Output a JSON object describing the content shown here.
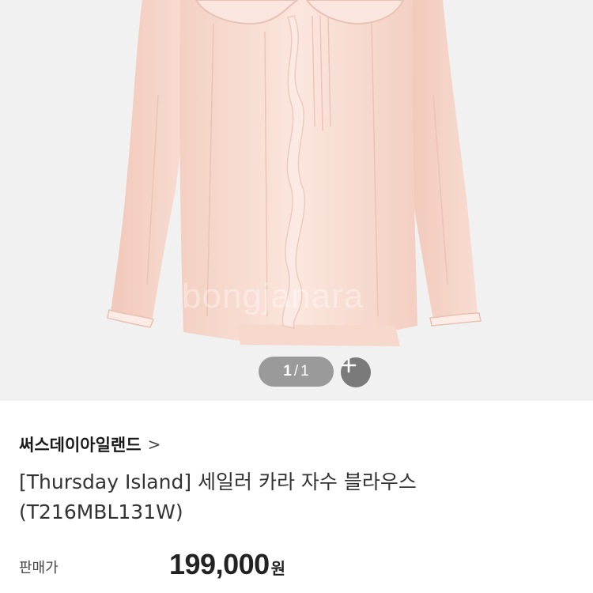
{
  "gallery": {
    "current": "1",
    "separator": "/",
    "total": "1",
    "zoom_icon": "plus-icon",
    "watermark": "bongjanara",
    "colors": {
      "background": "#f1f1f1",
      "blouse": "#f8ddd3",
      "pill": "#7a7a7a"
    }
  },
  "product": {
    "brand": "써스데이아일랜드",
    "brand_chevron": ">",
    "name_line1": "[Thursday Island] 세일러 카라 자수 블라우스",
    "name_line2": "(T216MBL131W)",
    "price_label": "판매가",
    "price": "199,000",
    "price_unit": "원"
  }
}
